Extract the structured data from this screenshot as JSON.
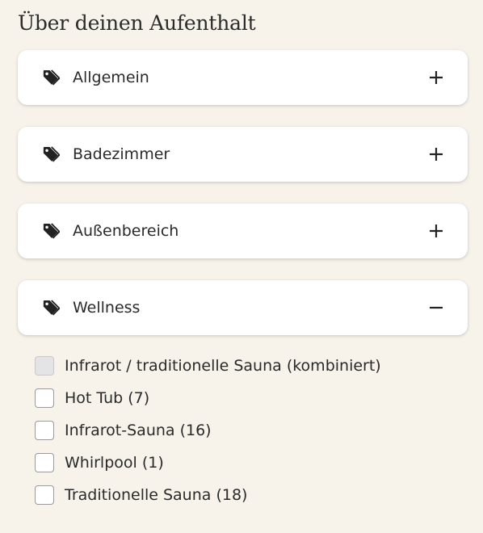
{
  "section": {
    "title": "Über deinen Aufenthalt"
  },
  "accordions": [
    {
      "label": "Allgemein",
      "icon": "tag-icon",
      "toggle_icon": "plus-icon",
      "expanded": false
    },
    {
      "label": "Badezimmer",
      "icon": "tag-icon",
      "toggle_icon": "plus-icon",
      "expanded": false
    },
    {
      "label": "Außenbereich",
      "icon": "tag-icon",
      "toggle_icon": "plus-icon",
      "expanded": false
    },
    {
      "label": "Wellness",
      "icon": "tag-icon",
      "toggle_icon": "minus-icon",
      "expanded": true
    }
  ],
  "wellness_options": [
    {
      "label": "Infrarot / traditionelle Sauna (kombiniert)",
      "checked": false,
      "disabled": true
    },
    {
      "label": "Hot Tub (7)",
      "checked": false,
      "disabled": false
    },
    {
      "label": "Infrarot-Sauna (16)",
      "checked": false,
      "disabled": false
    },
    {
      "label": "Whirlpool (1)",
      "checked": false,
      "disabled": false
    },
    {
      "label": "Traditionelle Sauna (18)",
      "checked": false,
      "disabled": false
    }
  ],
  "colors": {
    "page_background": "#f7f2ea",
    "card_background": "#ffffff",
    "text": "#2a2a2a",
    "checkbox_border": "#9a9a9a",
    "checkbox_disabled": "#e4e4e6"
  }
}
